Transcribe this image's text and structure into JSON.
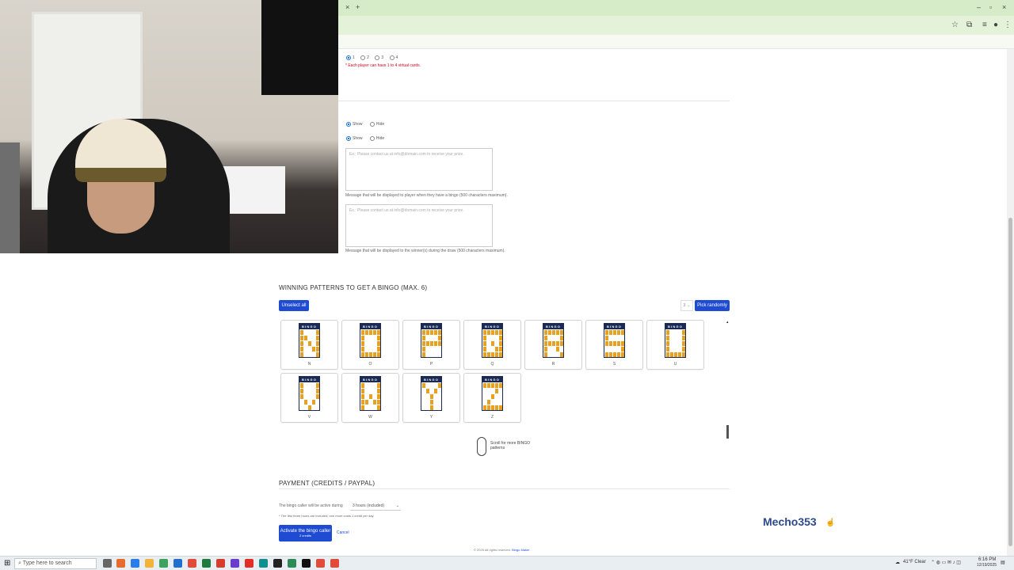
{
  "browser": {
    "tab_close": "×",
    "new_tab": "+",
    "window_controls": [
      "–",
      "▫",
      "×"
    ]
  },
  "cards_section": {
    "options": [
      "1",
      "2",
      "3",
      "4"
    ],
    "selected": "1",
    "note": "* Each player can have 1 to 4 virtual cards."
  },
  "display_options": {
    "row1": {
      "show": "Show",
      "hide": "Hide"
    },
    "row2": {
      "show": "Show",
      "hide": "Hide"
    }
  },
  "messages": {
    "bingo_placeholder": "Ex.: Please contact us at info@domain.com to receive your prize.",
    "bingo_hint": "Message that will be displayed to player when they have a bingo (500 characters maximum).",
    "winner_placeholder": "Ex.: Please contact us at info@domain.com to receive your prize.",
    "winner_hint": "Message that will be displayed to the winner(s) during the draw (500 characters maximum)."
  },
  "patterns": {
    "title": "WINNING PATTERNS TO GET A BINGO (MAX. 6)",
    "unselect_label": "Unselect all",
    "count_value": "3",
    "pick_label": "Pick randomly",
    "header_letters": "BINGO",
    "items": [
      {
        "label": "N",
        "cells": [
          1,
          0,
          0,
          0,
          1,
          1,
          1,
          0,
          0,
          1,
          1,
          0,
          1,
          0,
          1,
          1,
          0,
          0,
          1,
          1,
          1,
          0,
          0,
          0,
          1
        ]
      },
      {
        "label": "O",
        "cells": [
          1,
          1,
          1,
          1,
          1,
          1,
          0,
          0,
          0,
          1,
          1,
          0,
          0,
          0,
          1,
          1,
          0,
          0,
          0,
          1,
          1,
          1,
          1,
          1,
          1
        ]
      },
      {
        "label": "P",
        "cells": [
          1,
          1,
          1,
          1,
          1,
          1,
          0,
          0,
          0,
          1,
          1,
          1,
          1,
          1,
          1,
          1,
          0,
          0,
          0,
          0,
          1,
          0,
          0,
          0,
          0
        ]
      },
      {
        "label": "Q",
        "cells": [
          1,
          1,
          1,
          1,
          1,
          1,
          0,
          0,
          0,
          1,
          1,
          0,
          1,
          0,
          1,
          1,
          0,
          0,
          1,
          1,
          1,
          1,
          1,
          1,
          1
        ]
      },
      {
        "label": "R",
        "cells": [
          1,
          1,
          1,
          1,
          1,
          1,
          0,
          0,
          0,
          1,
          1,
          1,
          1,
          1,
          1,
          1,
          0,
          0,
          1,
          0,
          1,
          0,
          0,
          0,
          1
        ]
      },
      {
        "label": "S",
        "cells": [
          1,
          1,
          1,
          1,
          1,
          1,
          0,
          0,
          0,
          0,
          1,
          1,
          1,
          1,
          1,
          0,
          0,
          0,
          0,
          1,
          1,
          1,
          1,
          1,
          1
        ]
      },
      {
        "label": "U",
        "cells": [
          1,
          0,
          0,
          0,
          1,
          1,
          0,
          0,
          0,
          1,
          1,
          0,
          0,
          0,
          1,
          1,
          0,
          0,
          0,
          1,
          1,
          1,
          1,
          1,
          1
        ]
      },
      {
        "label": "V",
        "cells": [
          1,
          0,
          0,
          0,
          1,
          1,
          0,
          0,
          0,
          1,
          1,
          0,
          0,
          0,
          1,
          0,
          1,
          0,
          1,
          0,
          0,
          0,
          1,
          0,
          0
        ]
      },
      {
        "label": "W",
        "cells": [
          1,
          0,
          0,
          0,
          1,
          1,
          0,
          0,
          0,
          1,
          1,
          0,
          1,
          0,
          1,
          1,
          1,
          0,
          1,
          1,
          1,
          0,
          0,
          0,
          1
        ]
      },
      {
        "label": "Y",
        "cells": [
          1,
          0,
          0,
          0,
          1,
          0,
          1,
          0,
          1,
          0,
          0,
          0,
          1,
          0,
          0,
          0,
          0,
          1,
          0,
          0,
          0,
          0,
          1,
          0,
          0
        ]
      },
      {
        "label": "Z",
        "cells": [
          1,
          1,
          1,
          1,
          1,
          0,
          0,
          0,
          1,
          0,
          0,
          0,
          1,
          0,
          0,
          0,
          1,
          0,
          0,
          0,
          1,
          1,
          1,
          1,
          1
        ]
      }
    ],
    "scroll_hint": "Scroll for more BINGO patterns"
  },
  "payment": {
    "title": "PAYMENT (CREDITS / PAYPAL)",
    "duration_label": "The bingo caller will be active during",
    "duration_value": "3 hours (included)",
    "duration_note": "* The first three hours are included, one more costs 1 credit per day.",
    "activate_label": "Activate the bingo caller",
    "activate_sub": "2 credits",
    "cancel_label": "Cancel"
  },
  "footer": {
    "text": "© 2025 All rights reserved.",
    "link": "Bingo Maker"
  },
  "watermark": "Mecho353",
  "taskbar": {
    "search_placeholder": "Type here to search",
    "weather": "41°F Clear",
    "time": "6:16 PM",
    "date": "12/19/2025"
  },
  "colors": {
    "accent": "#1e4bd2",
    "pattern_fill": "#e8a020",
    "pattern_header": "#1b2a55",
    "note_red": "#d0021b"
  }
}
